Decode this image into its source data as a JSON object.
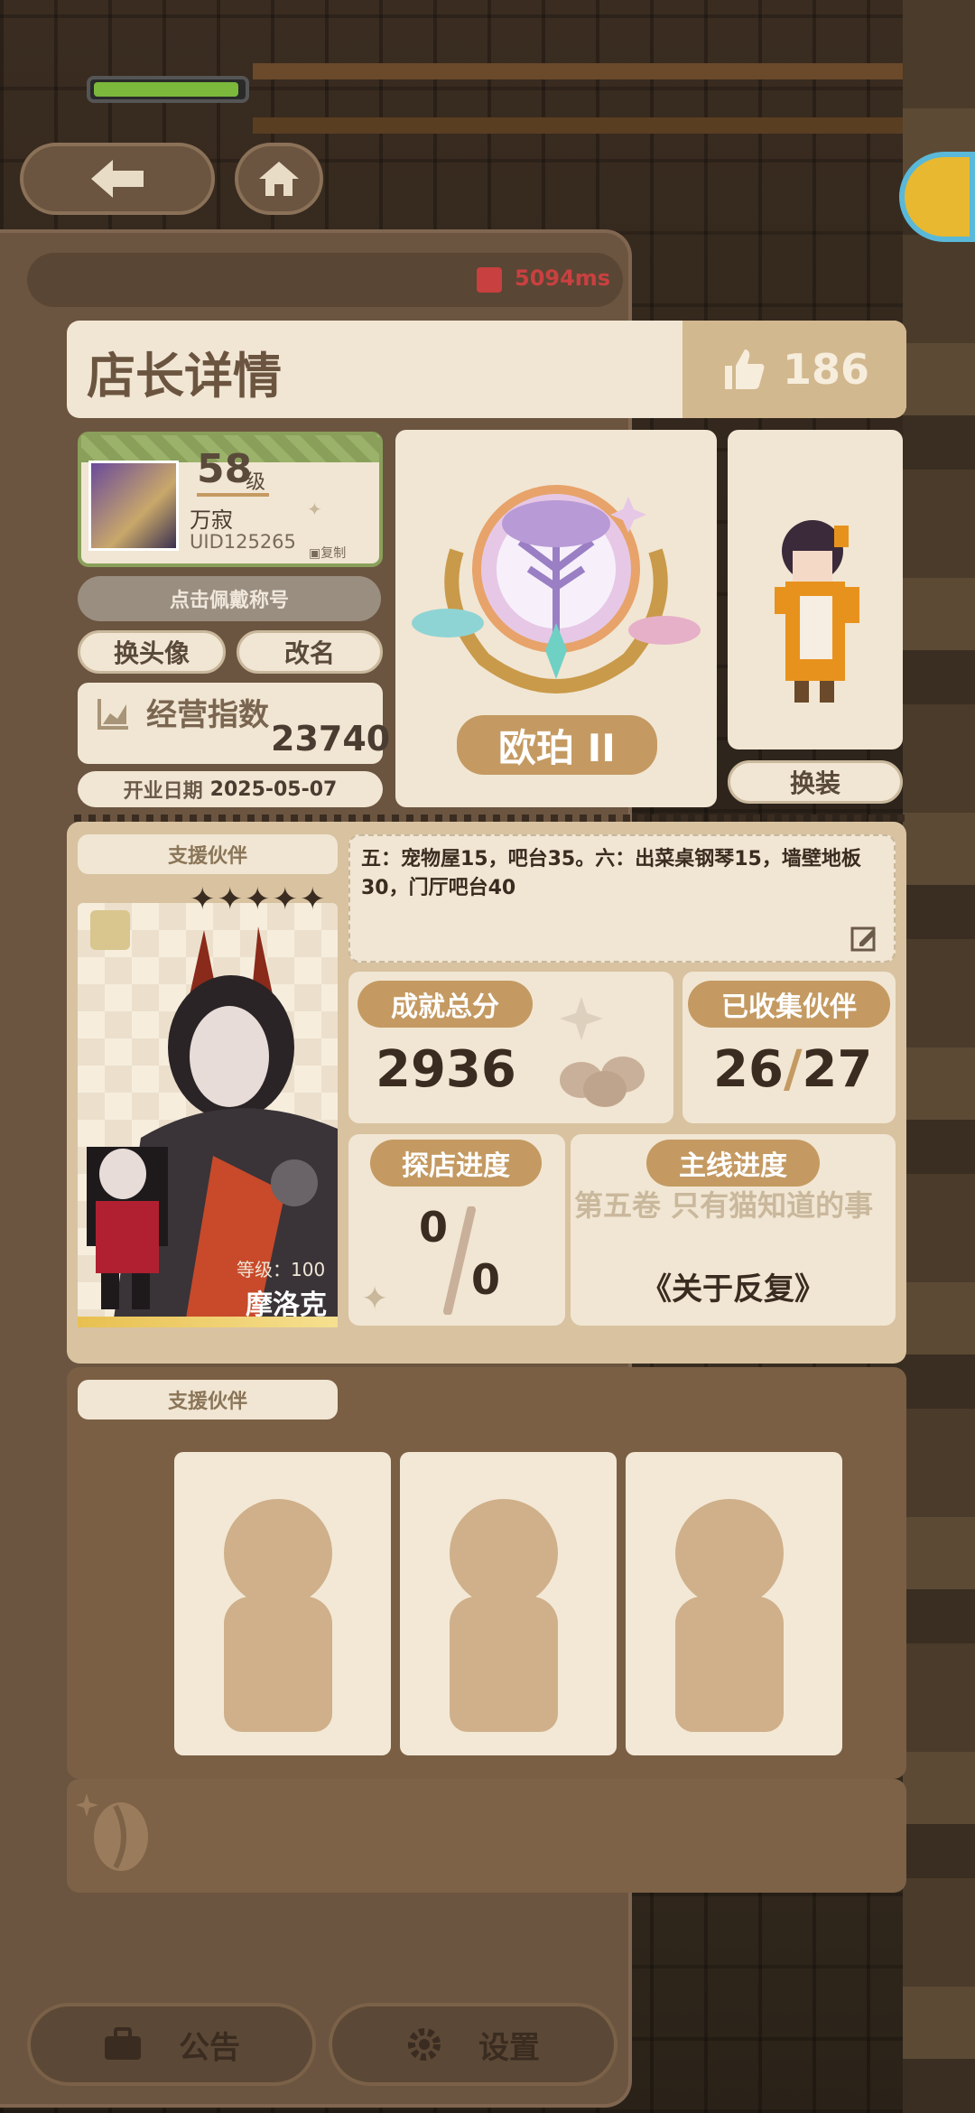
{
  "topbar": {
    "back_icon": "arrow-left-icon",
    "home_icon": "home-icon",
    "ping": "5094ms"
  },
  "header": {
    "title": "店长详情",
    "likes": "186"
  },
  "profile": {
    "level": "58",
    "level_suffix": "级",
    "name": "万寂",
    "uid": "UID125265",
    "copy_label": "复制",
    "title_placeholder": "点击佩戴称号",
    "change_avatar": "换头像",
    "rename": "改名",
    "business_index_label": "经营指数",
    "business_index_value": "23740",
    "open_date_label": "开业日期",
    "open_date_value": "2025-05-07"
  },
  "badge": {
    "rank": "欧珀 II"
  },
  "outfit": {
    "change_label": "换装"
  },
  "support": {
    "label": "支援伙伴",
    "stars": "✦✦✦✦✦",
    "level_text": "等级：100",
    "name": "摩洛克"
  },
  "note": {
    "text": "五：宠物屋15，吧台35。六：出菜桌钢琴15，墙壁地板30，门厅吧台40"
  },
  "stats": {
    "achievement_label": "成就总分",
    "achievement_value": "2936",
    "partners_label": "已收集伙伴",
    "partners_collected": "26",
    "partners_total": "27",
    "visit_label": "探店进度",
    "visit_done": "0",
    "visit_total": "0",
    "story_label": "主线进度",
    "story_chapter": "第五卷 只有猫知道的事",
    "story_episode": "《关于反复》"
  },
  "support2": {
    "label": "支援伙伴"
  },
  "bottom": {
    "notice": "公告",
    "settings": "设置"
  },
  "colors": {
    "panel": "#6b5540",
    "card": "#f1e6d3",
    "accent": "#c49a62",
    "ping": "#c94040"
  }
}
